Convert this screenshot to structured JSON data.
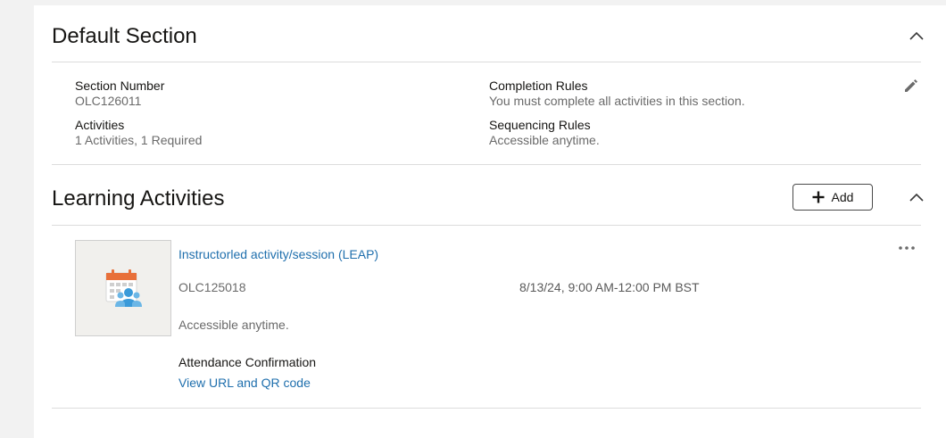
{
  "default_section": {
    "title": "Default Section",
    "section_number_label": "Section Number",
    "section_number_value": "OLC126011",
    "activities_label": "Activities",
    "activities_value": "1 Activities, 1 Required",
    "completion_rules_label": "Completion Rules",
    "completion_rules_value": "You must complete all activities in this section.",
    "sequencing_rules_label": "Sequencing Rules",
    "sequencing_rules_value": "Accessible anytime."
  },
  "learning_activities": {
    "title": "Learning Activities",
    "add_label": "Add",
    "items": [
      {
        "title": "Instructorled activity/session (LEAP)",
        "code": "OLC125018",
        "schedule": "8/13/24, 9:00 AM-12:00 PM BST",
        "access": "Accessible anytime.",
        "attendance_label": "Attendance Confirmation",
        "attendance_link": "View URL and QR code",
        "thumbnail_icon": "calendar-people-icon"
      }
    ]
  },
  "colors": {
    "link": "#1f6fad",
    "muted_text": "#6a6a6a",
    "divider": "#dcdcdc",
    "icon_orange": "#e8703a",
    "icon_blue": "#3a9ad9"
  }
}
